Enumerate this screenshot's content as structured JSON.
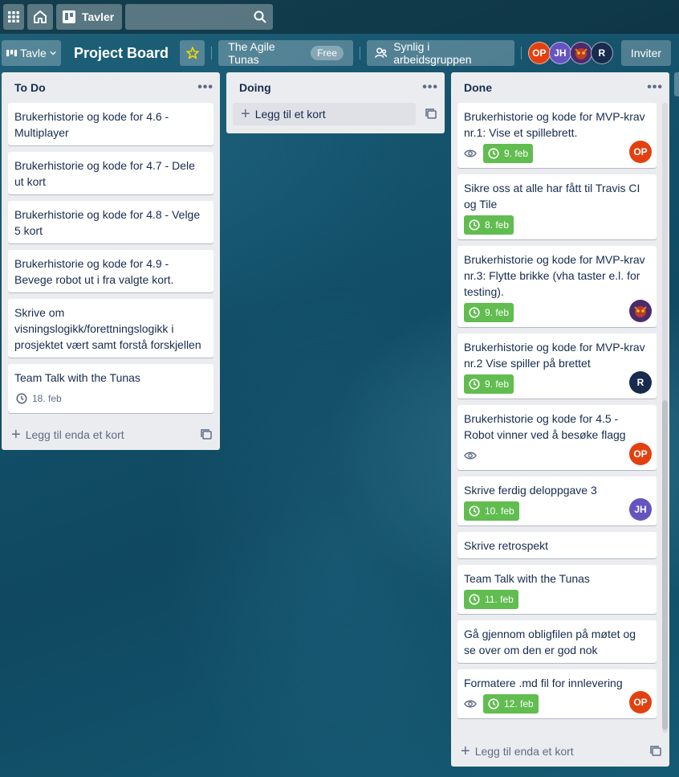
{
  "header": {
    "boards_label": "Tavler",
    "search_placeholder": ""
  },
  "board": {
    "view_label": "Tavle",
    "title": "Project Board",
    "team_name": "The Agile Tunas",
    "team_plan": "Free",
    "visibility": "Synlig i arbeidsgruppen",
    "invite_label": "Inviter",
    "members": [
      {
        "initials": "OP",
        "color": "#e2410f"
      },
      {
        "initials": "JH",
        "color": "#6554c0"
      },
      {
        "initials": "",
        "color": "#4a2b6b"
      },
      {
        "initials": "R",
        "color": "#172b4d"
      }
    ]
  },
  "lists": [
    {
      "title": "To Do",
      "footer": "Legg til enda et kort",
      "cards": [
        {
          "title": "Brukerhistorie og kode for 4.6 - Multiplayer"
        },
        {
          "title": "Brukerhistorie og kode for 4.7 - Dele ut kort"
        },
        {
          "title": "Brukerhistorie og kode for 4.8 - Velge 5 kort"
        },
        {
          "title": "Brukerhistorie og kode for 4.9 - Bevege robot ut i fra valgte kort."
        },
        {
          "title": "Skrive om visningslogikk/forettningslogikk i prosjektet vært samt forstå forskjellen"
        },
        {
          "title": "Team Talk with the Tunas",
          "due": "18. feb"
        }
      ]
    },
    {
      "title": "Doing",
      "add_label": "Legg til et kort"
    },
    {
      "title": "Done",
      "footer": "Legg til enda et kort",
      "cards": [
        {
          "title": "Brukerhistorie og kode for MVP-krav nr.1: Vise et spillebrett.",
          "due": "9. feb",
          "member": "OP"
        },
        {
          "title": "Sikre oss at alle har fått til Travis CI og Tile",
          "due": "8. feb"
        },
        {
          "title": "Brukerhistorie og kode for MVP-krav nr.3: Flytte brikke (vha taster e.l. for testing).",
          "due": "9. feb"
        },
        {
          "title": "Brukerhistorie og kode for MVP-krav nr.2 Vise spiller på brettet",
          "due": "9. feb",
          "member": "R"
        },
        {
          "title": "Brukerhistorie og kode for 4.5 - Robot vinner ved å besøke flagg",
          "member": "OP"
        },
        {
          "title": "Skrive ferdig deloppgave 3",
          "due": "10. feb",
          "member": "JH"
        },
        {
          "title": "Skrive retrospekt"
        },
        {
          "title": "Team Talk with the Tunas",
          "due": "11. feb"
        },
        {
          "title": "Gå gjennom obligfilen på møtet og se over om den er god nok"
        },
        {
          "title": "Formatere .md fil for innlevering",
          "due": "12. feb",
          "member": "OP"
        }
      ]
    }
  ],
  "colors": {
    "due_complete": "#61bd4f",
    "list_bg": "#ebecf0",
    "avatar_op": "#e2410f",
    "avatar_jh": "#6554c0",
    "avatar_r": "#172b4d"
  }
}
